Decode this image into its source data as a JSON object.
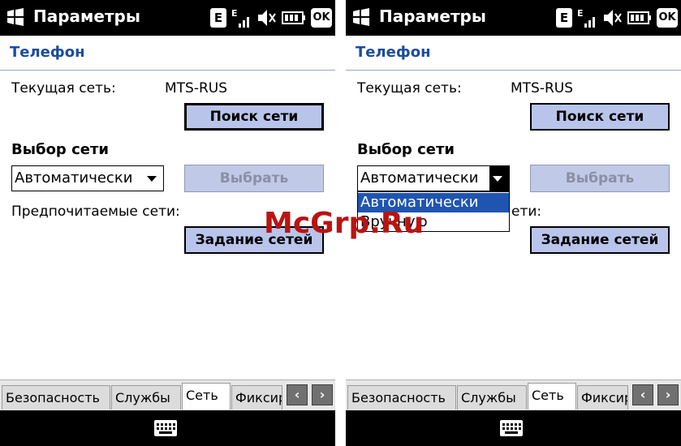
{
  "app_title": "Параметры",
  "status": {
    "edge": "E",
    "signal_edge": "E",
    "ok": "OK"
  },
  "header": "Телефон",
  "current_network_label": "Текущая сеть:",
  "current_network_value": "MTS-RUS",
  "search_button": "Поиск сети",
  "network_select_label": "Выбор сети",
  "combo_value": "Автоматически",
  "select_button": "Выбрать",
  "preferred_label": "Предпочитаемые сети:",
  "preferred_label_partial": "ети:",
  "set_networks_button": "Задание сетей",
  "dropdown_options": [
    "Автоматически",
    "Вручную"
  ],
  "tabs": [
    "Безопасность",
    "Службы",
    "Сеть",
    "Фиксир"
  ],
  "active_tab": "Сеть",
  "watermark": "McGrp.Ru"
}
